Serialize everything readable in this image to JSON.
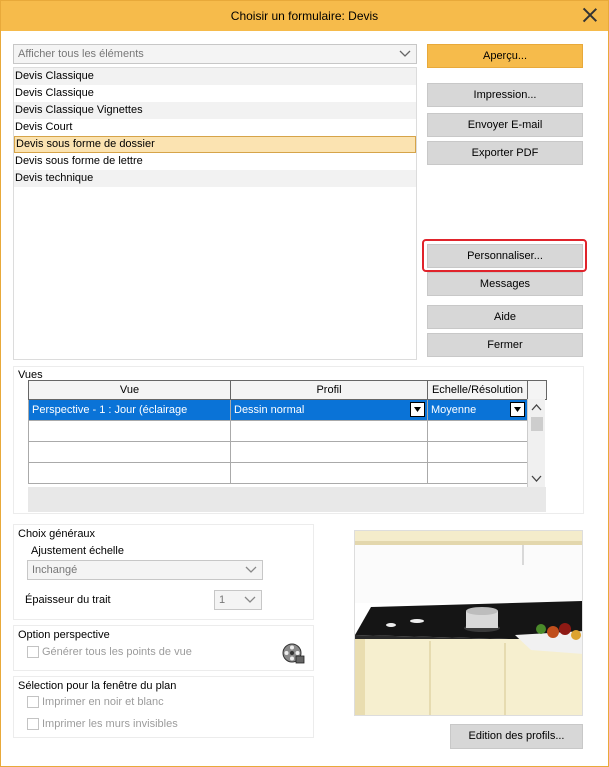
{
  "window": {
    "title": "Choisir un formulaire: Devis"
  },
  "filter": {
    "value": "Afficher tous les éléments"
  },
  "forms": [
    "Devis Classique",
    "Devis Classique",
    "Devis Classique Vignettes",
    "Devis Court",
    "Devis sous forme de dossier",
    "Devis sous forme de lettre",
    "Devis technique"
  ],
  "selected_form_index": 4,
  "buttons": {
    "apercu": "Aperçu...",
    "impression": "Impression...",
    "envoyer": "Envoyer E-mail",
    "exporter": "Exporter PDF",
    "personnaliser": "Personnaliser...",
    "messages": "Messages",
    "aide": "Aide",
    "fermer": "Fermer",
    "edition": "Edition des profils..."
  },
  "vues": {
    "label": "Vues",
    "headers": [
      "Vue",
      "Profil",
      "Echelle/Résolution"
    ],
    "row": {
      "vue": "Perspective - 1 : Jour (éclairage",
      "profil": "Dessin normal",
      "echelle": "Moyenne"
    }
  },
  "choix": {
    "label": "Choix généraux",
    "ajustement_label": "Ajustement échelle",
    "ajustement_value": "Inchangé",
    "epaisseur_label": "Épaisseur du trait",
    "epaisseur_value": "1"
  },
  "perspective": {
    "label": "Option perspective",
    "generer": "Générer tous les points de vue"
  },
  "plan": {
    "label": "Sélection pour la fenêtre du plan",
    "noir_blanc": "Imprimer en noir et blanc",
    "murs": "Imprimer les murs invisibles"
  },
  "colors": {
    "accent": "#f6bb4b",
    "selection": "#0a73d7",
    "highlight": "#e0232b",
    "row_selected": "#fbe3b1"
  }
}
